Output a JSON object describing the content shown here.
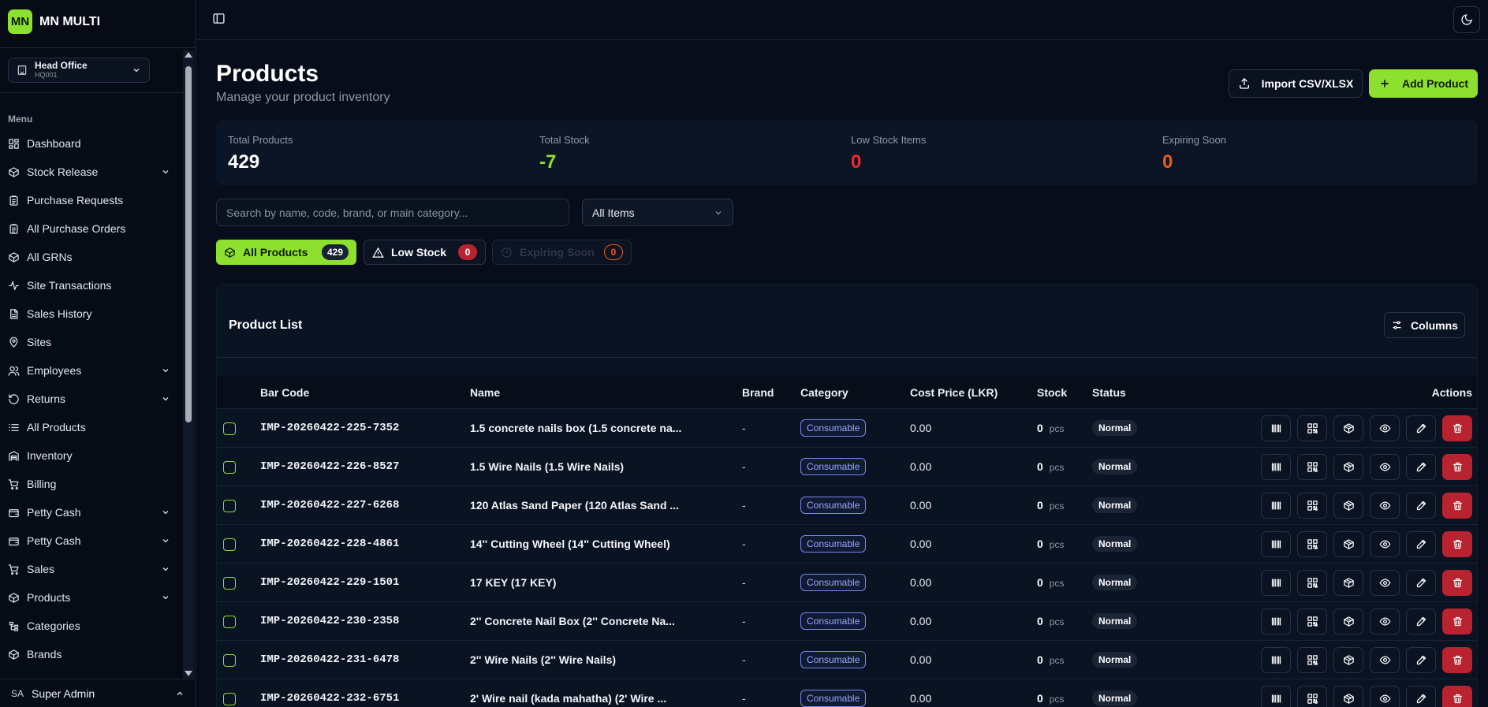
{
  "brand": {
    "logo": "MN",
    "name": "MN MULTI"
  },
  "branch": {
    "name": "Head Office",
    "code": "HQ001",
    "icon": "building-icon"
  },
  "menu_label": "Menu",
  "menu": [
    {
      "label": "Dashboard",
      "icon": "dashboard-icon",
      "chevron": false,
      "key": "dashboard"
    },
    {
      "label": "Stock Release",
      "icon": "box-icon",
      "chevron": true,
      "key": "stock-release"
    },
    {
      "label": "Purchase Requests",
      "icon": "clipboard-icon",
      "chevron": false,
      "key": "purchase-requests"
    },
    {
      "label": "All Purchase Orders",
      "icon": "clipboard-icon",
      "chevron": false,
      "key": "purchase-orders"
    },
    {
      "label": "All GRNs",
      "icon": "box-icon",
      "chevron": false,
      "key": "grns"
    },
    {
      "label": "Site Transactions",
      "icon": "activity-icon",
      "chevron": false,
      "key": "site-transactions"
    },
    {
      "label": "Sales History",
      "icon": "document-icon",
      "chevron": false,
      "key": "sales-history"
    },
    {
      "label": "Sites",
      "icon": "map-pin-icon",
      "chevron": false,
      "key": "sites"
    },
    {
      "label": "Employees",
      "icon": "users-icon",
      "chevron": true,
      "key": "employees"
    },
    {
      "label": "Returns",
      "icon": "rotate-icon",
      "chevron": true,
      "key": "returns"
    },
    {
      "label": "All Products",
      "icon": "list-icon",
      "chevron": false,
      "key": "all-products"
    },
    {
      "label": "Inventory",
      "icon": "warehouse-icon",
      "chevron": false,
      "key": "inventory"
    },
    {
      "label": "Billing",
      "icon": "cart-icon",
      "chevron": false,
      "key": "billing"
    },
    {
      "label": "Petty Cash",
      "icon": "wallet-icon",
      "chevron": true,
      "key": "petty-cash-1"
    },
    {
      "label": "Petty Cash",
      "icon": "wallet-icon",
      "chevron": true,
      "key": "petty-cash-2"
    },
    {
      "label": "Sales",
      "icon": "cart-icon",
      "chevron": true,
      "key": "sales"
    },
    {
      "label": "Products",
      "icon": "box-icon",
      "chevron": true,
      "key": "products"
    },
    {
      "label": "Categories",
      "icon": "tree-icon",
      "chevron": false,
      "key": "categories"
    },
    {
      "label": "Brands",
      "icon": "box-icon",
      "chevron": false,
      "key": "brands"
    }
  ],
  "user": {
    "initials": "SA",
    "name": "Super Admin"
  },
  "page": {
    "title": "Products",
    "subtitle": "Manage your product inventory"
  },
  "buttons": {
    "import": "Import CSV/XLSX",
    "add": "Add Product",
    "columns": "Columns"
  },
  "stats": [
    {
      "label": "Total Products",
      "value": "429",
      "color": "#ffffff"
    },
    {
      "label": "Total Stock",
      "value": "-7",
      "color": "#8ee02e"
    },
    {
      "label": "Low Stock Items",
      "value": "0",
      "color": "#ef2b2b"
    },
    {
      "label": "Expiring Soon",
      "value": "0",
      "color": "#f05a14"
    }
  ],
  "search": {
    "placeholder": "Search by name, code, brand, or main category...",
    "value": ""
  },
  "filter": {
    "selected": "All Items"
  },
  "chips": {
    "all": {
      "label": "All Products",
      "count": "429"
    },
    "low": {
      "label": "Low Stock",
      "count": "0"
    },
    "expiring": {
      "label": "Expiring Soon",
      "count": "0"
    }
  },
  "table": {
    "title": "Product List",
    "headers": {
      "barcode": "Bar Code",
      "name": "Name",
      "brand": "Brand",
      "category": "Category",
      "cost": "Cost Price (LKR)",
      "stock": "Stock",
      "status": "Status",
      "actions": "Actions"
    },
    "rows": [
      {
        "barcode": "IMP-20260422-225-7352",
        "name": "1.5 concrete nails box (1.5 concrete na...",
        "brand": "-",
        "category": "Consumable",
        "cost": "0.00",
        "stock": "0",
        "unit": "pcs",
        "status": "Normal"
      },
      {
        "barcode": "IMP-20260422-226-8527",
        "name": "1.5 Wire Nails (1.5 Wire Nails)",
        "brand": "-",
        "category": "Consumable",
        "cost": "0.00",
        "stock": "0",
        "unit": "pcs",
        "status": "Normal"
      },
      {
        "barcode": "IMP-20260422-227-6268",
        "name": "120 Atlas Sand Paper (120 Atlas Sand ...",
        "brand": "-",
        "category": "Consumable",
        "cost": "0.00",
        "stock": "0",
        "unit": "pcs",
        "status": "Normal"
      },
      {
        "barcode": "IMP-20260422-228-4861",
        "name": "14'' Cutting Wheel (14'' Cutting Wheel)",
        "brand": "-",
        "category": "Consumable",
        "cost": "0.00",
        "stock": "0",
        "unit": "pcs",
        "status": "Normal"
      },
      {
        "barcode": "IMP-20260422-229-1501",
        "name": "17 KEY (17 KEY)",
        "brand": "-",
        "category": "Consumable",
        "cost": "0.00",
        "stock": "0",
        "unit": "pcs",
        "status": "Normal"
      },
      {
        "barcode": "IMP-20260422-230-2358",
        "name": "2'' Concrete Nail Box (2'' Concrete Na...",
        "brand": "-",
        "category": "Consumable",
        "cost": "0.00",
        "stock": "0",
        "unit": "pcs",
        "status": "Normal"
      },
      {
        "barcode": "IMP-20260422-231-6478",
        "name": "2'' Wire Nails (2'' Wire Nails)",
        "brand": "-",
        "category": "Consumable",
        "cost": "0.00",
        "stock": "0",
        "unit": "pcs",
        "status": "Normal"
      },
      {
        "barcode": "IMP-20260422-232-6751",
        "name": "2' Wire nail (kada mahatha) (2' Wire ...",
        "brand": "-",
        "category": "Consumable",
        "cost": "0.00",
        "stock": "0",
        "unit": "pcs",
        "status": "Normal"
      }
    ]
  },
  "row_actions": [
    "barcode-icon",
    "qr-icon",
    "package-icon",
    "eye-icon",
    "edit-icon",
    "trash-icon"
  ]
}
